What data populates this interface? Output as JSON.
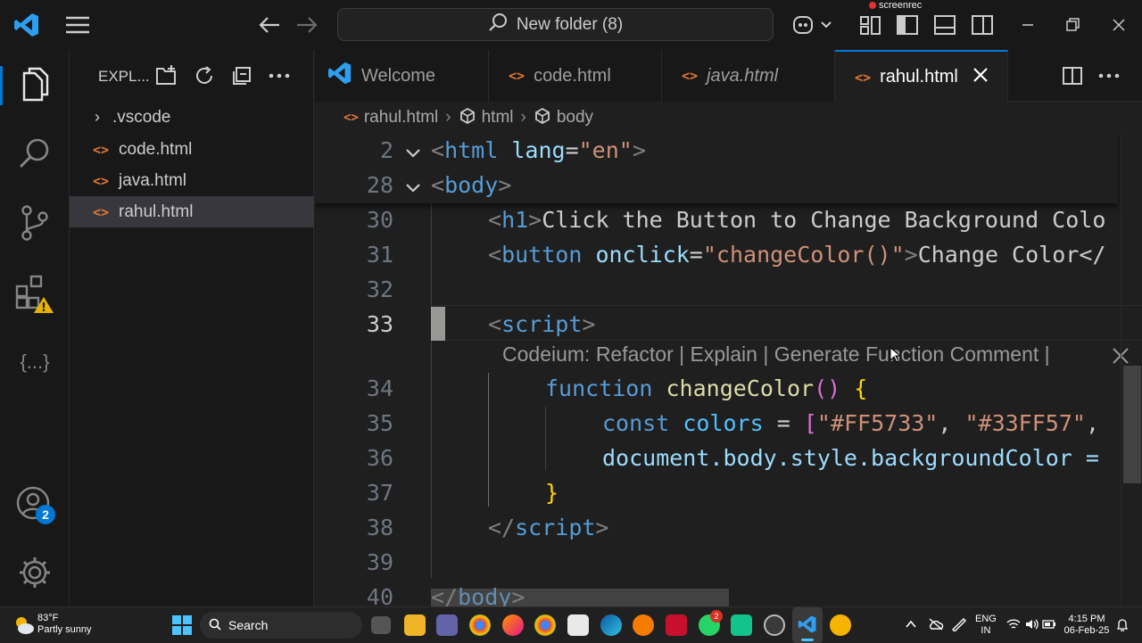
{
  "titlebar": {
    "search_text": "New folder (8)",
    "recorder_label": "screenrec"
  },
  "activity_bar": {
    "items": [
      "explorer-icon",
      "search-icon",
      "source-control-icon",
      "extensions-icon",
      "json-icon"
    ],
    "accounts_badge": "2",
    "extensions_warning": "!",
    "json_label": "{...}"
  },
  "sidebar": {
    "title": "EXPL...",
    "files": [
      {
        "name": ".vscode",
        "type": "folder"
      },
      {
        "name": "code.html",
        "type": "html"
      },
      {
        "name": "java.html",
        "type": "html"
      },
      {
        "name": "rahul.html",
        "type": "html",
        "selected": true
      }
    ],
    "file_icon_glyph": "<>"
  },
  "tabs": [
    {
      "label": "Welcome",
      "icon": "vscode-icon"
    },
    {
      "label": "code.html",
      "icon": "html-icon"
    },
    {
      "label": "java.html",
      "icon": "html-icon",
      "italic": true
    },
    {
      "label": "rahul.html",
      "icon": "html-icon",
      "active": true
    }
  ],
  "breadcrumb": {
    "file": "rahul.html",
    "items": [
      "html",
      "body"
    ]
  },
  "editor": {
    "line_numbers": {
      "l2": "2",
      "l28": "28",
      "l30": "30",
      "l31": "31",
      "l32": "32",
      "l33": "33",
      "l34": "34",
      "l35": "35",
      "l36": "36",
      "l37": "37",
      "l38": "38",
      "l39": "39",
      "l40": "40"
    },
    "codelens": "Codeium: Refactor | Explain | Generate Function Comment | ",
    "code": {
      "l2_tag": "html",
      "l2_attr": "lang",
      "l2_val": "\"en\"",
      "l28_tag": "body",
      "l30_tag": "h1",
      "l30_text": "Click the Button to Change Background Colo",
      "l31_tag": "button",
      "l31_attr": "onclick",
      "l31_val": "\"changeColor()\"",
      "l31_text": "Change Color</",
      "l33_tag": "script",
      "l34_kw": "function",
      "l34_fn": "changeColor",
      "l34_paren": "()",
      "l34_brace": "{",
      "l35_kw": "const",
      "l35_var": "colors",
      "l35_eq": "=",
      "l35_br": "[",
      "l35_s1": "\"#FF5733\"",
      "l35_s2": "\"#33FF57\"",
      "l36_text": "document.body.style.backgroundColor =",
      "l37_brace": "}",
      "l38_tag": "script",
      "l40_tag": "body"
    }
  },
  "taskbar": {
    "weather_temp": "83°F",
    "weather_desc": "Partly sunny",
    "search_label": "Search",
    "lang_top": "ENG",
    "lang_bottom": "IN",
    "time": "4:15 PM",
    "date": "06-Feb-25",
    "whatsapp_badge": "2"
  }
}
